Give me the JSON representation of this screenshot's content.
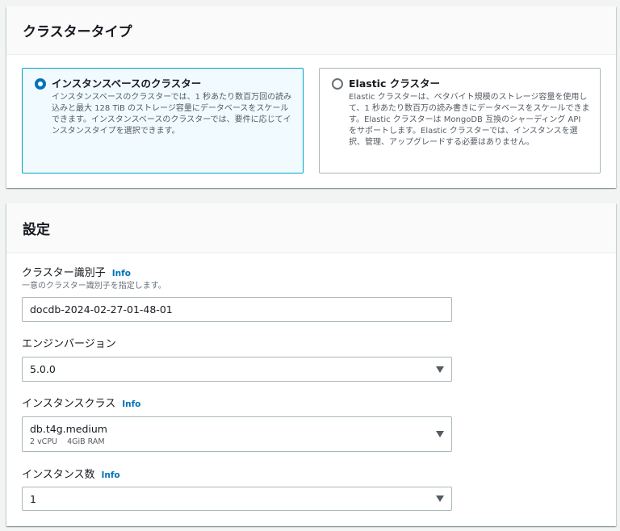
{
  "cluster_type": {
    "heading": "クラスタータイプ",
    "options": [
      {
        "title": "インスタンスベースのクラスター",
        "description": "インスタンスベースのクラスターでは、1 秒あたり数百万回の読み込みと最大 128 TiB のストレージ容量にデータベースをスケールできます。インスタンスベースのクラスターでは、要件に応じてインスタンスタイプを選択できます。",
        "selected": true
      },
      {
        "title": "Elastic クラスター",
        "description": "Elastic クラスターは、ペタバイト規模のストレージ容量を使用して、1 秒あたり数百万の読み書きにデータベースをスケールできます。Elastic クラスターは MongoDB 互換のシャーディング API をサポートします。Elastic クラスターでは、インスタンスを選択、管理、アップグレードする必要はありません。",
        "selected": false
      }
    ]
  },
  "settings": {
    "heading": "設定",
    "info_label": "Info",
    "cluster_identifier": {
      "label": "クラスター識別子",
      "hint": "一意のクラスター識別子を指定します。",
      "value": "docdb-2024-02-27-01-48-01"
    },
    "engine_version": {
      "label": "エンジンバージョン",
      "value": "5.0.0"
    },
    "instance_class": {
      "label": "インスタンスクラス",
      "value": "db.t4g.medium",
      "detail": "2 vCPU    4GiB RAM"
    },
    "instance_count": {
      "label": "インスタンス数",
      "value": "1"
    }
  },
  "colors": {
    "accent": "#0073bb",
    "selected_tile_bg": "#f1faff",
    "selected_tile_border": "#00a1c9"
  }
}
